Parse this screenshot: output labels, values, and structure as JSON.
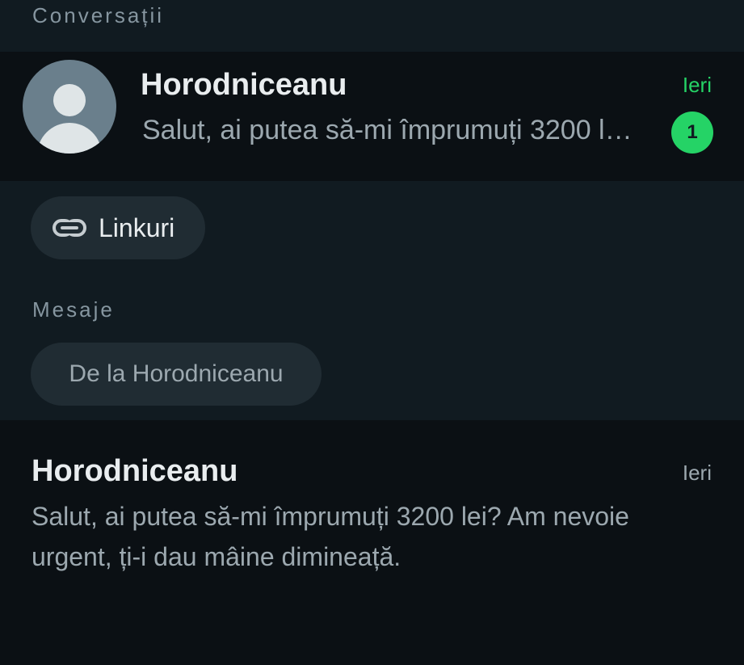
{
  "sections": {
    "conversations_header": "Conversații",
    "messages_header": "Mesaje"
  },
  "conversation": {
    "name": "Horodniceanu",
    "time": "Ieri",
    "preview": "Salut, ai putea să-mi împrumuți 3200 l…",
    "unread_count": "1",
    "avatar_icon": "default-avatar-icon"
  },
  "filters": {
    "links_label": "Linkuri",
    "links_icon": "link-icon",
    "from_label": "De la Horodniceanu"
  },
  "message_result": {
    "sender": "Horodniceanu",
    "time": "Ieri",
    "body": "Salut, ai putea să-mi împrumuți 3200 lei? Am nevoie urgent, ți-i dau mâine dimineață."
  },
  "colors": {
    "background": "#111b21",
    "row_background": "#0b1014",
    "chip_background": "#202c33",
    "accent_green": "#25d366",
    "secondary_text": "#8696a0"
  }
}
